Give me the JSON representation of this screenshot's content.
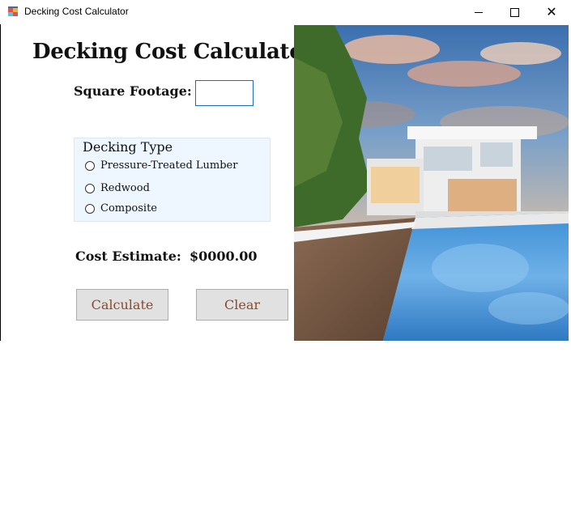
{
  "window": {
    "title": "Decking Cost Calculator",
    "minimize_symbol": "",
    "close_symbol": "✕"
  },
  "form": {
    "heading": "Decking Cost Calculator",
    "square_footage_label": "Square Footage:",
    "square_footage_value": "",
    "decking_type": {
      "title": "Decking Type",
      "options": [
        "Pressure-Treated Lumber",
        "Redwood",
        "Composite"
      ],
      "selected": null
    },
    "cost_label": "Cost Estimate:",
    "cost_value": "$0000.00",
    "calculate_label": "Calculate",
    "clear_label": "Clear"
  },
  "image": {
    "subject": "modern white house with pool at sunset",
    "icon": "house-photo"
  },
  "colors": {
    "button_text": "#8b4a2a",
    "group_background": "#eef7ff",
    "input_border": "#1a6fb3"
  }
}
